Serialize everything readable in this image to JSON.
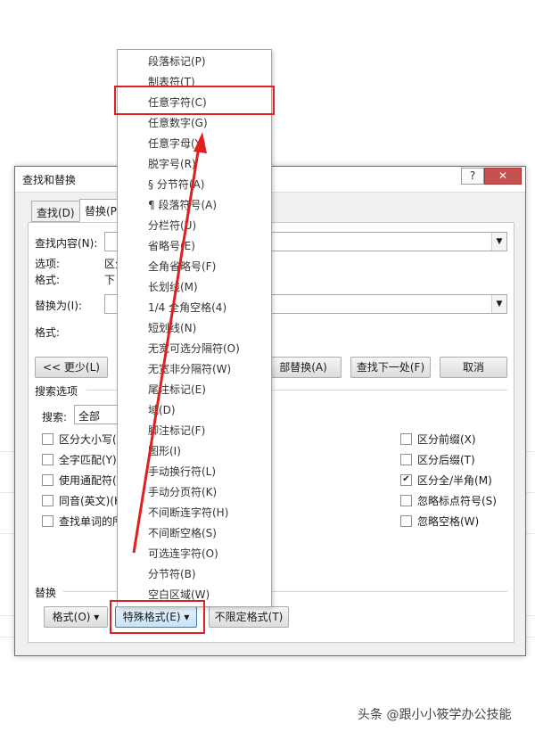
{
  "dialog": {
    "title": "查找和替换",
    "help": "?",
    "close": "✕",
    "tabs": [
      "查找(D)",
      "替换(P)"
    ],
    "find_label": "查找内容(N):",
    "options_label": "选项:",
    "options_value": "区分",
    "format_label": "格式:",
    "format_value": "下",
    "replace_label": "替换为(I):",
    "replace_format_label": "格式:",
    "less_button": "<< 更少(L)",
    "replace_all_button": "部替换(A)",
    "find_next_button": "查找下一处(F)",
    "cancel_button": "取消",
    "search_options_label": "搜索选项",
    "search_label": "搜索:",
    "search_value": "全部",
    "left_options": [
      "区分大小写(",
      "全字匹配(Y)",
      "使用通配符(U",
      "同音(英文)(K",
      "查找单词的所"
    ],
    "right_options": [
      "区分前缀(X)",
      "区分后缀(T)",
      "区分全/半角(M)",
      "忽略标点符号(S)",
      "忽略空格(W)"
    ],
    "right_checked": [
      false,
      false,
      true,
      false,
      false
    ],
    "replace_section_label": "替换",
    "format_button": "格式(O) ▾",
    "special_format_button": "特殊格式(E) ▾",
    "no_format_button": "不限定格式(T)"
  },
  "menu": {
    "items": [
      "段落标记(P)",
      "制表符(T)",
      "任意字符(C)",
      "任意数字(G)",
      "任意字母(Y)",
      "脱字号(R)",
      "§ 分节符(A)",
      "¶ 段落符号(A)",
      "分栏符(U)",
      "省略号(E)",
      "全角省略号(F)",
      "长划线(M)",
      "1/4 全角空格(4)",
      "短划线(N)",
      "无宽可选分隔符(O)",
      "无宽非分隔符(W)",
      "尾注标记(E)",
      "域(D)",
      "脚注标记(F)",
      "图形(I)",
      "手动换行符(L)",
      "手动分页符(K)",
      "不间断连字符(H)",
      "不间断空格(S)",
      "可选连字符(O)",
      "分节符(B)",
      "空白区域(W)"
    ]
  },
  "annotation": {
    "color": "#e02020"
  },
  "watermark": "头条 @跟小小筱学办公技能"
}
